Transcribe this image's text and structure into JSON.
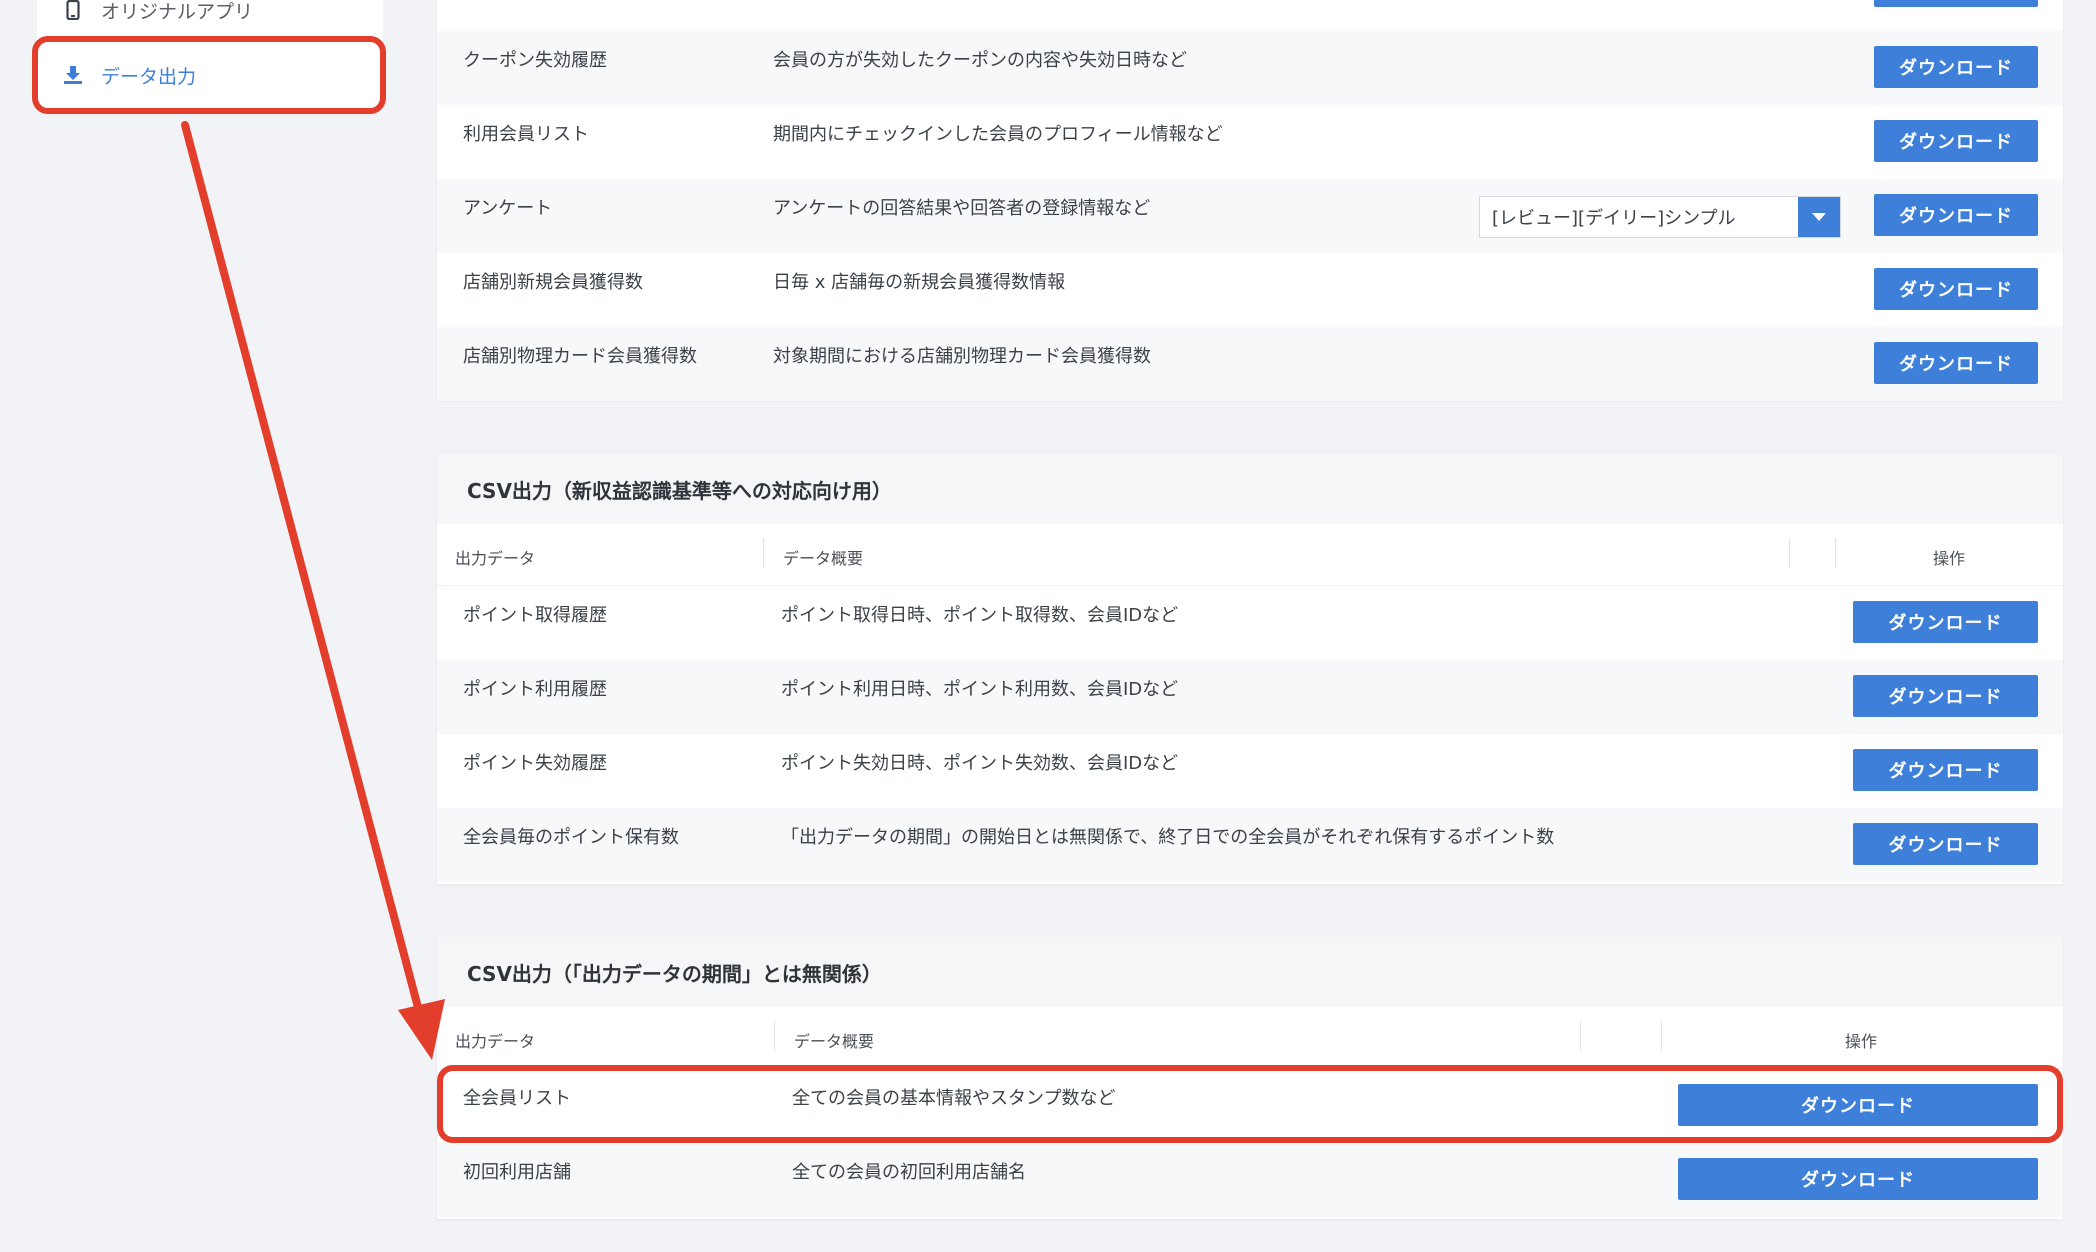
{
  "sidebar": {
    "items": [
      {
        "label": "オリジナルアプリ",
        "icon": "phone-icon"
      },
      {
        "label": "データ出力",
        "icon": "download-icon"
      }
    ]
  },
  "panel1": {
    "download_label": "ダウンロード",
    "rows": [
      {
        "name": "クーポン失効履歴",
        "desc": "会員の方が失効したクーポンの内容や失効日時など"
      },
      {
        "name": "利用会員リスト",
        "desc": "期間内にチェックインした会員のプロフィール情報など"
      },
      {
        "name": "アンケート",
        "desc": "アンケートの回答結果や回答者の登録情報など",
        "select_value": "[レビュー][デイリー]シンプル"
      },
      {
        "name": "店舗別新規会員獲得数",
        "desc": "日毎 x 店舗毎の新規会員獲得数情報"
      },
      {
        "name": "店舗別物理カード会員獲得数",
        "desc": "対象期間における店舗別物理カード会員獲得数"
      }
    ]
  },
  "panel2": {
    "title": "CSV出力（新収益認識基準等への対応向け用）",
    "col_output": "出力データ",
    "col_summary": "データ概要",
    "col_action": "操作",
    "download_label": "ダウンロード",
    "rows": [
      {
        "name": "ポイント取得履歴",
        "desc": "ポイント取得日時、ポイント取得数、会員IDなど"
      },
      {
        "name": "ポイント利用履歴",
        "desc": "ポイント利用日時、ポイント利用数、会員IDなど"
      },
      {
        "name": "ポイント失効履歴",
        "desc": "ポイント失効日時、ポイント失効数、会員IDなど"
      },
      {
        "name": "全会員毎のポイント保有数",
        "desc": "「出力データの期間」の開始日とは無関係で、終了日での全会員がそれぞれ保有するポイント数"
      }
    ]
  },
  "panel3": {
    "title": "CSV出力（「出力データの期間」とは無関係）",
    "col_output": "出力データ",
    "col_summary": "データ概要",
    "col_action": "操作",
    "download_label": "ダウンロード",
    "rows": [
      {
        "name": "全会員リスト",
        "desc": "全ての会員の基本情報やスタンプ数など"
      },
      {
        "name": "初回利用店舗",
        "desc": "全ての会員の初回利用店舗名"
      }
    ]
  },
  "colors": {
    "accent": "#3e7fd9",
    "annotation": "#e23e2b"
  }
}
